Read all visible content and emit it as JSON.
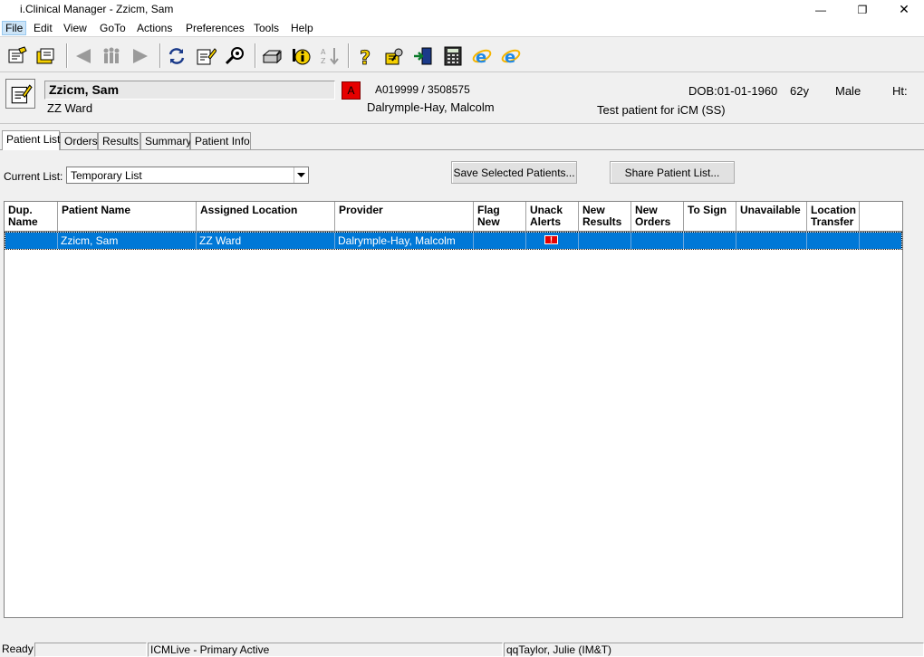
{
  "window": {
    "title": "i.Clinical Manager - Zzicm, Sam",
    "minimize_glyph": "—",
    "maximize_glyph": "❐",
    "close_glyph": "✕"
  },
  "menu": [
    "File",
    "Edit",
    "View",
    "GoTo",
    "Actions",
    "Preferences",
    "Tools",
    "Help"
  ],
  "toolbar": {
    "icons": [
      "patient-list-icon",
      "open-chart-icon",
      "back-arrow-icon",
      "people-icon",
      "forward-arrow-icon",
      "refresh-icon",
      "edit-note-icon",
      "search-patient-icon",
      "print-icon",
      "info-icon",
      "sort-az-icon",
      "help-icon",
      "settings-icon",
      "exit-icon",
      "calculator-icon",
      "internet-explorer-icon",
      "internet-explorer-2-icon"
    ]
  },
  "banner": {
    "patient_name": "Zzicm, Sam",
    "ward": "ZZ Ward",
    "alert_letter": "A",
    "identifiers": "A019999 / 3508575",
    "provider": "Dalrymple-Hay, Malcolm",
    "dob": "DOB:01-01-1960",
    "age": "62y",
    "sex": "Male",
    "height_label": "Ht:",
    "note": "Test patient for iCM (SS)"
  },
  "tabs": [
    "Patient List",
    "Orders",
    "Results",
    "Summary",
    "Patient Info"
  ],
  "list_controls": {
    "current_list_label": "Current List:",
    "current_list_value": "Temporary List",
    "save_button": "Save Selected Patients...",
    "share_button": "Share Patient List..."
  },
  "table": {
    "columns": [
      [
        "Dup.",
        "Name"
      ],
      [
        "Patient Name",
        ""
      ],
      [
        "Assigned Location",
        ""
      ],
      [
        "Provider",
        ""
      ],
      [
        "Flag",
        "New"
      ],
      [
        "Unack",
        "Alerts"
      ],
      [
        "New",
        "Results"
      ],
      [
        "New",
        "Orders"
      ],
      [
        "To Sign",
        ""
      ],
      [
        "Unavailable",
        ""
      ],
      [
        "Location",
        "Transfer"
      ]
    ],
    "rows": [
      {
        "dup_name": "",
        "patient_name": "Zzicm, Sam",
        "assigned_location": "ZZ Ward",
        "provider": "Dalrymple-Hay, Malcolm",
        "flag_new": "",
        "unack_alert_glyph": "!",
        "new_results": "",
        "new_orders": "",
        "to_sign": "",
        "unavailable": "",
        "location_transfer": ""
      }
    ],
    "selected_color": "#0078d7"
  },
  "status": {
    "state": "Ready",
    "pane2": "",
    "system": "ICMLive - Primary Active",
    "user": "qqTaylor, Julie (IM&T)"
  }
}
